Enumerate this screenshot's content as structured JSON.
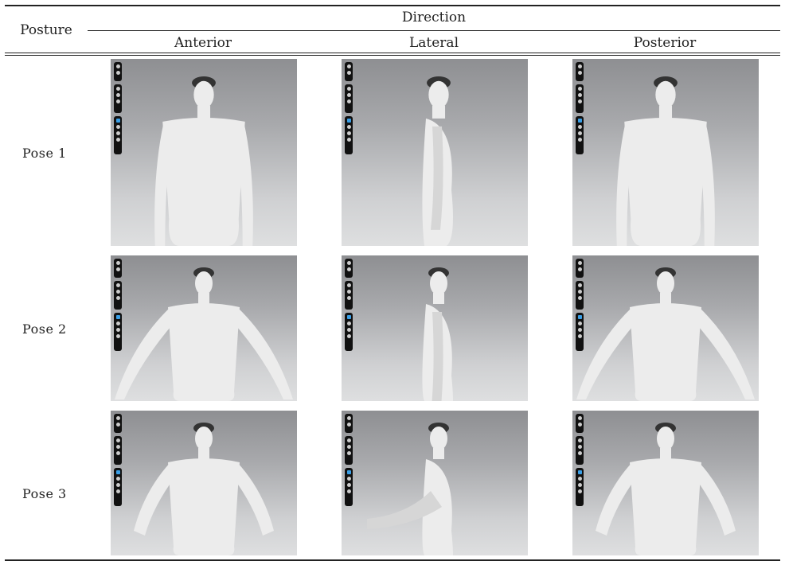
{
  "header": {
    "posture_label": "Posture",
    "direction_label": "Direction",
    "columns": [
      "Anterior",
      "Lateral",
      "Posterior"
    ]
  },
  "rows": [
    {
      "label": "Pose 1"
    },
    {
      "label": "Pose 2"
    },
    {
      "label": "Pose 3"
    }
  ],
  "colors": {
    "rule": "#222222",
    "viewport_top": "#8e8f92",
    "viewport_bottom": "#dedfe0",
    "body": "#ececec",
    "toolbar": "#111111",
    "toolbar_active": "#3aa0e8"
  }
}
